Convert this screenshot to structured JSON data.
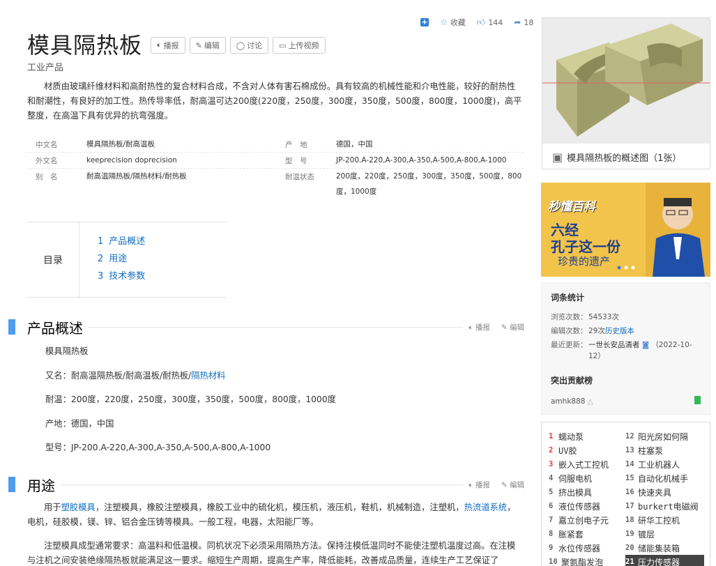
{
  "top_actions": {
    "favorite": "收藏",
    "likes": "144",
    "shares": "18"
  },
  "title": "模具隔热板",
  "title_buttons": [
    "播报",
    "编辑",
    "讨论",
    "上传视频"
  ],
  "subtitle": "工业产品",
  "summary": "材质由玻璃纤维材料和高耐热性的复合材料合成，不含对人体有害石棉成份。具有较高的机械性能和介电性能，较好的耐热性和耐潮性，有良好的加工性。热传导率低，耐高温可达200度(220度，250度，300度，350度，500度，800度，1000度)，高平整度，在高温下具有优异的抗弯强度。",
  "basic_info": [
    {
      "k1": "中文名",
      "v1": "模具隔热板/耐高温板",
      "k2": "产　地",
      "v2": "德国，中国"
    },
    {
      "k1": "外文名",
      "v1": "keeprecision doprecision",
      "k2": "型　号",
      "v2": "JP-200.A-220,A-300,A-350,A-500,A-800,A-1000"
    },
    {
      "k1": "别　名",
      "v1": "耐高温隔热板/隔热材料/耐热板",
      "k2": "耐温状态",
      "v2": "200度，220度，250度，300度，350度，500度，800度，1000度"
    }
  ],
  "toc": {
    "label": "目录",
    "items": [
      {
        "n": "1",
        "t": "产品概述"
      },
      {
        "n": "2",
        "t": "用途"
      },
      {
        "n": "3",
        "t": "技术参数"
      }
    ]
  },
  "section_tools": {
    "listen": "播报",
    "edit": "编辑"
  },
  "sections": {
    "overview": {
      "heading": "产品概述",
      "lines": {
        "name": "模具隔热板",
        "alias_prefix": "又名：耐高温隔热板/耐高温板/耐热板/",
        "alias_link": "隔热材料",
        "temp": "耐温：200度，220度，250度，300度，350度，500度，800度，1000度",
        "origin": "产地：德国，中国",
        "model": "型号：JP-200.A-220,A-300,A-350,A-500,A-800,A-1000"
      }
    },
    "usage": {
      "heading": "用途",
      "p1_a": "用于",
      "p1_link1": "塑胶模具",
      "p1_b": "，注塑模具，橡胶注塑模具，橡胶工业中的硫化机，模压机，液压机，鞋机，机械制造，注塑机，",
      "p1_link2": "热流道系统",
      "p1_c": "，电机，硅胶模，镁、锌、铝合金压铸等模具。一般工程，电器，太阳能厂等。",
      "p2": "注塑模具成型通常要求：高温料和低温模。同机状况下必须采用隔热方法。保持注模低温同时不能使注塑机温度过高。在注模与注机之间安装绝缘隔热板就能满足这一要求。缩短生产周期，提高生产率，降低能耗，改善成品质量，连续生产工艺保证了"
    }
  },
  "album": {
    "caption": "模具隔热板的概述图（1张）"
  },
  "ad": {
    "brand": "秒懂百科",
    "line1": "六经",
    "line2": "孔子这一份",
    "line3": "珍贵的遗产"
  },
  "stats": {
    "heading": "词条统计",
    "views_label": "浏览次数：",
    "views": "54533次",
    "edits_label": "编辑次数：",
    "edits": "29次",
    "history": "历史版本",
    "updated_label": "最近更新：",
    "updated_user": "一世长安品清者",
    "updated_date": "（2022-10-12）",
    "contrib_heading": "突出贡献榜",
    "contrib_user": "amhk888"
  },
  "hot_list": [
    {
      "n": "1",
      "t": "蠕动泵"
    },
    {
      "n": "12",
      "t": "阳光房如何隔"
    },
    {
      "n": "2",
      "t": "UV胶"
    },
    {
      "n": "13",
      "t": "柱塞泵"
    },
    {
      "n": "3",
      "t": "嵌入式工控机"
    },
    {
      "n": "14",
      "t": "工业机器人"
    },
    {
      "n": "4",
      "t": "伺服电机"
    },
    {
      "n": "15",
      "t": "自动化机械手"
    },
    {
      "n": "5",
      "t": "挤出模具"
    },
    {
      "n": "16",
      "t": "快速夹具"
    },
    {
      "n": "6",
      "t": "液位传感器"
    },
    {
      "n": "17",
      "t": "burkert电磁阀"
    },
    {
      "n": "7",
      "t": "嘉立创电子元"
    },
    {
      "n": "18",
      "t": "研华工控机"
    },
    {
      "n": "8",
      "t": "胀紧套"
    },
    {
      "n": "19",
      "t": "镀层"
    },
    {
      "n": "9",
      "t": "水位传感器"
    },
    {
      "n": "20",
      "t": "储能集装箱"
    },
    {
      "n": "10",
      "t": "聚氨酯发泡"
    },
    {
      "n": "21",
      "t": "压力传感器"
    }
  ],
  "colors": {
    "accent": "#4f9cee",
    "link": "#136ec2",
    "hot_red": "#e33333"
  }
}
